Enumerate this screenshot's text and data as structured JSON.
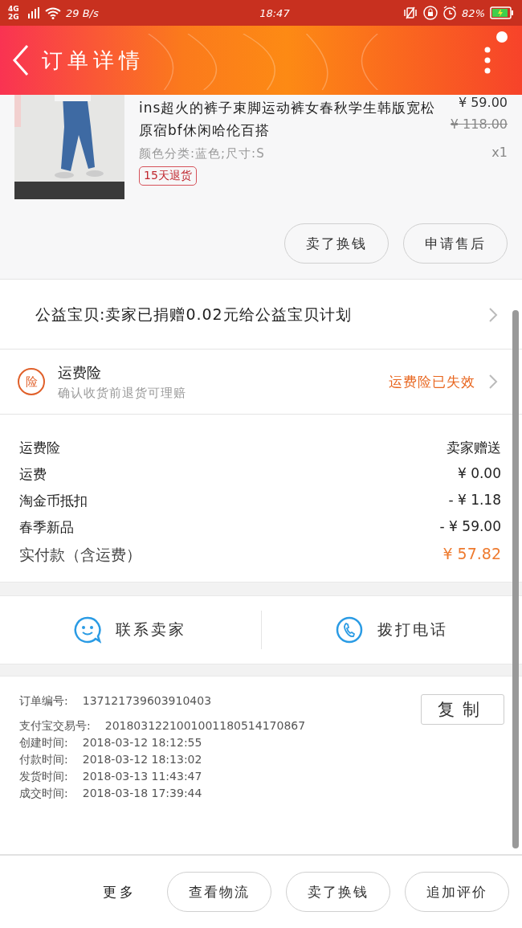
{
  "status_bar": {
    "network": "4G 2G",
    "speed": "29 B/s",
    "time": "18:47",
    "battery": "82%"
  },
  "header": {
    "title": "订单详情"
  },
  "product": {
    "title": "ins超火的裤子束脚运动裤女春秋学生韩版宽松原宿bf休闲哈伦百搭",
    "price": "¥ 59.00",
    "original_price": "¥ 118.00",
    "variant": "颜色分类:蓝色;尺寸:S",
    "quantity": "x1",
    "tag": "15天退货",
    "actions": [
      "卖了换钱",
      "申请售后"
    ]
  },
  "charity": {
    "text": "公益宝贝:卖家已捐赠0.02元给公益宝贝计划"
  },
  "insurance": {
    "badge": "险",
    "title": "运费险",
    "subtitle": "确认收货前退货可理赔",
    "status": "运费险已失效"
  },
  "costs": [
    {
      "label": "运费险",
      "value": "卖家赠送",
      "kind": "normal"
    },
    {
      "label": "运费",
      "value": "¥ 0.00",
      "kind": "normal"
    },
    {
      "label": "淘金币抵扣",
      "value": "- ¥ 1.18",
      "kind": "normal"
    },
    {
      "label": "春季新品",
      "value": "- ¥ 59.00",
      "kind": "normal"
    },
    {
      "label": "实付款（含运费）",
      "value": "¥ 57.82",
      "kind": "total"
    }
  ],
  "contact": [
    {
      "label": "联系卖家",
      "kind": "chat"
    },
    {
      "label": "拨打电话",
      "kind": "phone"
    }
  ],
  "order_info": {
    "copy_button": "复制",
    "rows": [
      {
        "label": "订单编号:",
        "value": "137121739603910403"
      },
      {
        "label": "支付宝交易号:",
        "value": "2018031221001001180514170867"
      },
      {
        "label": "创建时间:",
        "value": "2018-03-12 18:12:55"
      },
      {
        "label": "付款时间:",
        "value": "2018-03-12 18:13:02"
      },
      {
        "label": "发货时间:",
        "value": "2018-03-13 11:43:47"
      },
      {
        "label": "成交时间:",
        "value": "2018-03-18 17:39:44"
      }
    ]
  },
  "bottom_bar": {
    "more": "更多",
    "buttons": [
      "查看物流",
      "卖了换钱",
      "追加评价"
    ]
  }
}
